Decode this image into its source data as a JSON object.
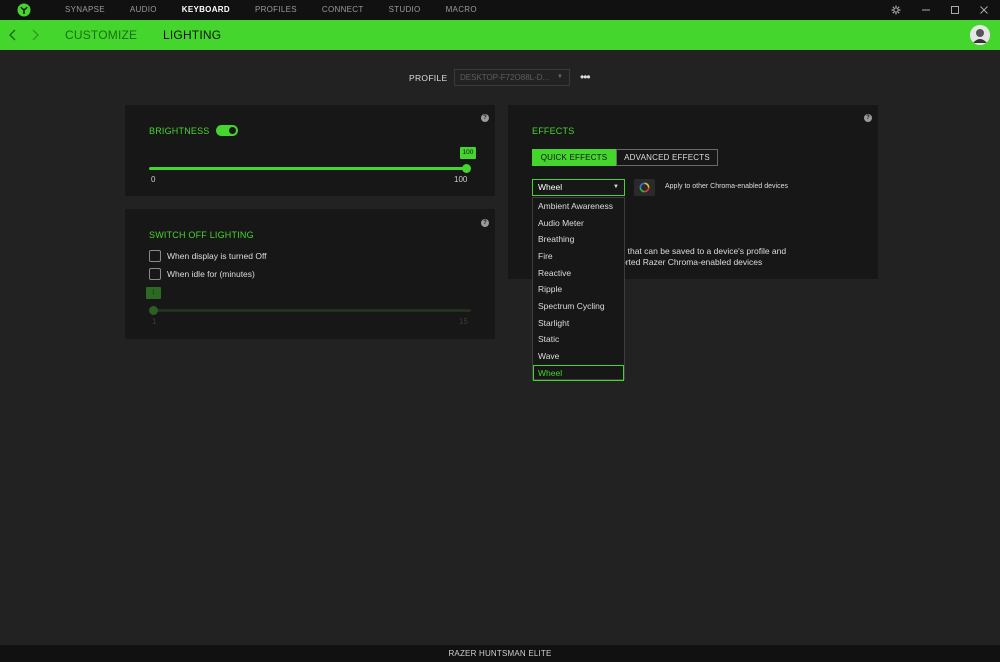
{
  "topnav": [
    "SYNAPSE",
    "AUDIO",
    "KEYBOARD",
    "PROFILES",
    "CONNECT",
    "STUDIO",
    "MACRO"
  ],
  "active_nav": "KEYBOARD",
  "subnav": {
    "customize": "CUSTOMIZE",
    "lighting": "LIGHTING"
  },
  "profile": {
    "label": "PROFILE",
    "value": "DESKTOP-F72O88L-D...",
    "more": "•••"
  },
  "brightness": {
    "title": "BRIGHTNESS",
    "enabled": true,
    "value": "100",
    "min": "0",
    "max": "100",
    "level": 1.0
  },
  "switch_off": {
    "title": "SWITCH OFF LIGHTING",
    "display_off": "When display is turned Off",
    "idle": "When idle for (minutes)",
    "slider_value": "1",
    "min": "1",
    "max": "15"
  },
  "effects": {
    "title": "EFFECTS",
    "tab_quick": "QUICK EFFECTS",
    "tab_advanced": "ADVANCED EFFECTS",
    "selected": "Wheel",
    "apply_label": "Apply to other Chroma-enabled devices",
    "desc_line1": "s that can be saved to a device's profile and",
    "desc_line2": "orted Razer Chroma-enabled devices",
    "options": [
      "Ambient Awareness",
      "Audio Meter",
      "Breathing",
      "Fire",
      "Reactive",
      "Ripple",
      "Spectrum Cycling",
      "Starlight",
      "Static",
      "Wave",
      "Wheel"
    ]
  },
  "help_glyph": "?",
  "device_name": "RAZER HUNTSMAN ELITE",
  "colors": {
    "accent": "#44d62c",
    "background": "#222222",
    "panel": "#171717",
    "titlebar": "#111111"
  }
}
